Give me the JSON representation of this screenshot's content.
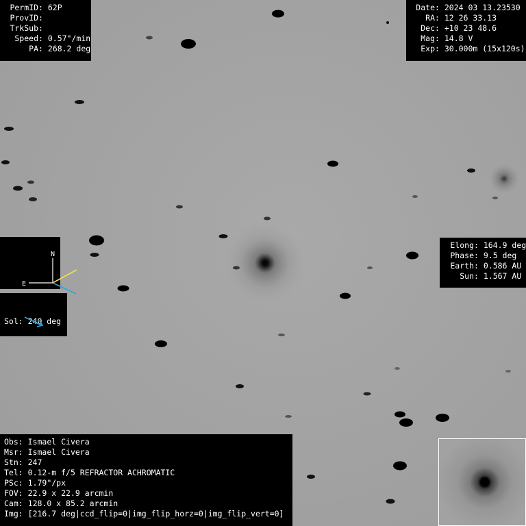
{
  "object": {
    "fields": [
      {
        "key": "PermID",
        "value": "62P"
      },
      {
        "key": "ProvID",
        "value": ""
      },
      {
        "key": "TrkSub",
        "value": ""
      },
      {
        "key": "Speed",
        "value": "0.57\"/min"
      },
      {
        "key": "PA",
        "value": "268.2 deg"
      }
    ]
  },
  "ephemeris": {
    "fields": [
      {
        "key": "Date",
        "value": "2024 03 13.23530"
      },
      {
        "key": "RA",
        "value": "12 26 33.13"
      },
      {
        "key": "Dec",
        "value": "+10 23 48.6"
      },
      {
        "key": "Mag",
        "value": "14.8 V"
      },
      {
        "key": "Exp",
        "value": "30.000m (15x120s)"
      }
    ]
  },
  "geometry": {
    "fields": [
      {
        "key": "Elong",
        "value": "164.9 deg"
      },
      {
        "key": "Phase",
        "value": "9.5 deg"
      },
      {
        "key": "Earth",
        "value": "0.586 AU"
      },
      {
        "key": "Sun",
        "value": "1.567 AU"
      }
    ]
  },
  "compass": {
    "north_label": "N",
    "east_label": "E",
    "motion_color": "#f5e04a",
    "sun_color": "#2aa8e0",
    "motion_pa_deg": 268.2
  },
  "sol": {
    "label": "Sol: 240 deg",
    "arrow_color": "#2aa8e0"
  },
  "observation": {
    "fields": [
      {
        "key": "Obs",
        "value": "Ismael Civera"
      },
      {
        "key": "Msr",
        "value": "Ismael Civera"
      },
      {
        "key": "Stn",
        "value": "247"
      },
      {
        "key": "Tel",
        "value": "0.12-m f/5 REFRACTOR ACHROMATIC"
      },
      {
        "key": "PSc",
        "value": "1.79\"/px"
      },
      {
        "key": "FOV",
        "value": "22.9 x 22.9 arcmin"
      },
      {
        "key": "Cam",
        "value": "128.0 x 85.2 arcmin"
      },
      {
        "key": "Img",
        "value": "[216.7 deg|ccd_flip=0|img_flip_horz=0|img_flip_vert=0]"
      }
    ]
  }
}
